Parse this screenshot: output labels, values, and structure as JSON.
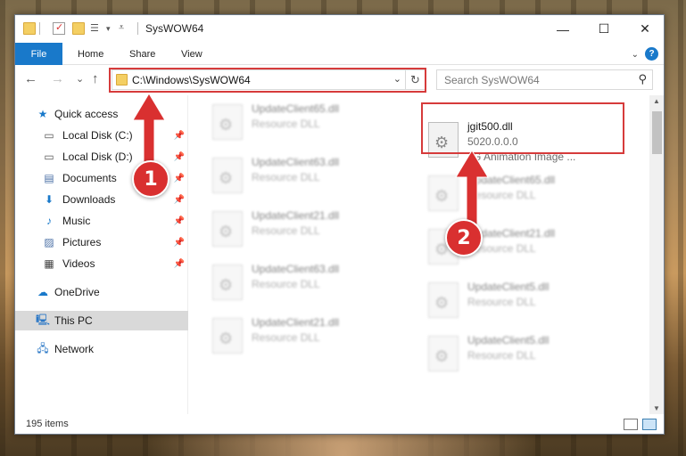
{
  "window": {
    "title": "SysWOW64",
    "minimize": "—",
    "maximize": "☐",
    "close": "✕"
  },
  "ribbon": {
    "tabs": [
      "File",
      "Home",
      "Share",
      "View"
    ]
  },
  "nav": {
    "back": "←",
    "forward": "→",
    "recent": "⌄",
    "up": "↑",
    "address": "C:\\Windows\\SysWOW64",
    "address_dropdown": "⌄",
    "refresh": "↻",
    "search_placeholder": "Search SysWOW64"
  },
  "sidebar": {
    "items": [
      {
        "label": "Quick access",
        "icon": "star-icon",
        "pinned": false
      },
      {
        "label": "Local Disk (C:)",
        "icon": "drive-icon",
        "pinned": true
      },
      {
        "label": "Local Disk (D:)",
        "icon": "drive-icon",
        "pinned": true
      },
      {
        "label": "Documents",
        "icon": "document-icon",
        "pinned": true
      },
      {
        "label": "Downloads",
        "icon": "download-icon",
        "pinned": true
      },
      {
        "label": "Music",
        "icon": "music-icon",
        "pinned": true
      },
      {
        "label": "Pictures",
        "icon": "picture-icon",
        "pinned": true
      },
      {
        "label": "Videos",
        "icon": "video-icon",
        "pinned": true
      },
      {
        "label": "OneDrive",
        "icon": "cloud-icon",
        "pinned": false
      },
      {
        "label": "This PC",
        "icon": "computer-icon",
        "pinned": false,
        "selected": true
      },
      {
        "label": "Network",
        "icon": "network-icon",
        "pinned": false
      }
    ]
  },
  "files": {
    "left_column": [
      {
        "name": "UpdateClient65.dll",
        "type": "Resource DLL"
      },
      {
        "name": "UpdateClient63.dll",
        "type": "Resource DLL"
      },
      {
        "name": "UpdateClient21.dll",
        "type": "Resource DLL"
      },
      {
        "name": "UpdateClient63.dll",
        "type": "Resource DLL"
      },
      {
        "name": "UpdateClient21.dll",
        "type": "Resource DLL"
      }
    ],
    "highlighted": {
      "name": "jgit500.dll",
      "version": "5020.0.0.0",
      "description": "JG Animation Image ..."
    },
    "right_column": [
      {
        "name": "UpdateClient65.dll",
        "type": "Resource DLL"
      },
      {
        "name": "UpdateClient21.dll",
        "type": "Resource DLL"
      },
      {
        "name": "UpdateClient5.dll",
        "type": "Resource DLL"
      },
      {
        "name": "UpdateClient5.dll",
        "type": "Resource DLL"
      }
    ]
  },
  "status": {
    "item_count": "195 items"
  },
  "annotations": {
    "marker1": "1",
    "marker2": "2",
    "accent_color": "#d93030"
  },
  "colors": {
    "file_tab": "#1979ca",
    "selected_nav": "#d9d9d9",
    "highlight": "#d63b3b"
  }
}
